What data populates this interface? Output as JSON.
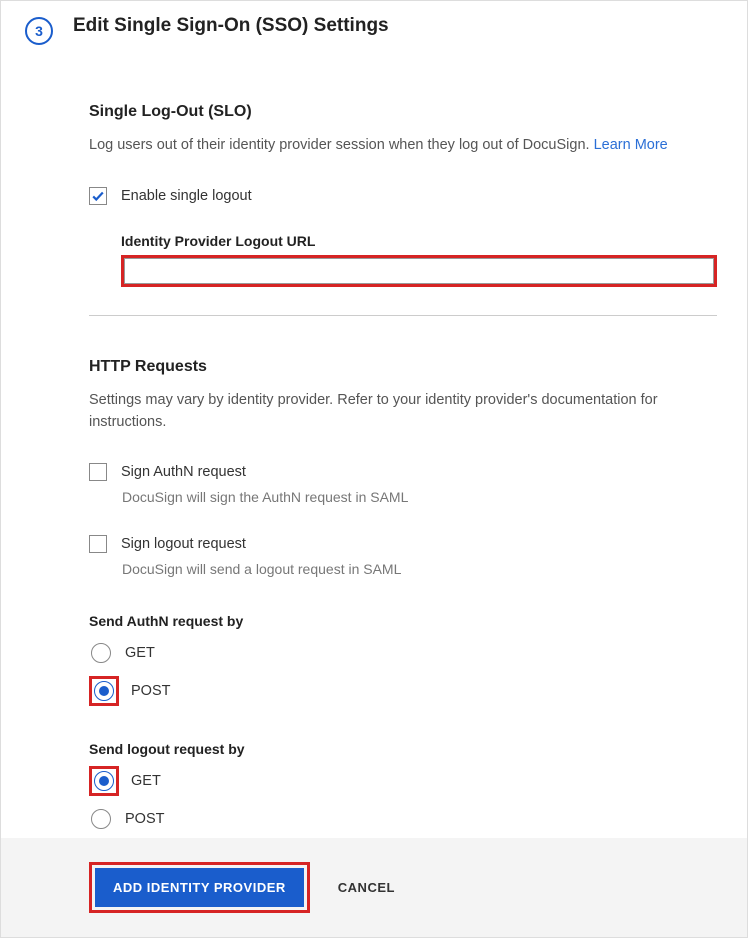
{
  "header": {
    "step_number": "3",
    "title": "Edit Single Sign-On (SSO) Settings"
  },
  "slo": {
    "title": "Single Log-Out (SLO)",
    "description": "Log users out of their identity provider session when they log out of DocuSign.",
    "learn_more": "Learn More",
    "enable_label": "Enable single logout",
    "enable_checked": true,
    "logout_url_label": "Identity Provider Logout URL",
    "logout_url_value": ""
  },
  "http": {
    "title": "HTTP Requests",
    "description": "Settings may vary by identity provider. Refer to your identity provider's documentation for instructions.",
    "sign_authn": {
      "label": "Sign AuthN request",
      "sub": "DocuSign will sign the AuthN request in SAML",
      "checked": false
    },
    "sign_logout": {
      "label": "Sign logout request",
      "sub": "DocuSign will send a logout request in SAML",
      "checked": false
    },
    "send_authn": {
      "group_label": "Send AuthN request by",
      "options": [
        "GET",
        "POST"
      ],
      "selected": "POST"
    },
    "send_logout": {
      "group_label": "Send logout request by",
      "options": [
        "GET",
        "POST"
      ],
      "selected": "GET"
    }
  },
  "footer": {
    "primary": "ADD IDENTITY PROVIDER",
    "secondary": "CANCEL"
  }
}
